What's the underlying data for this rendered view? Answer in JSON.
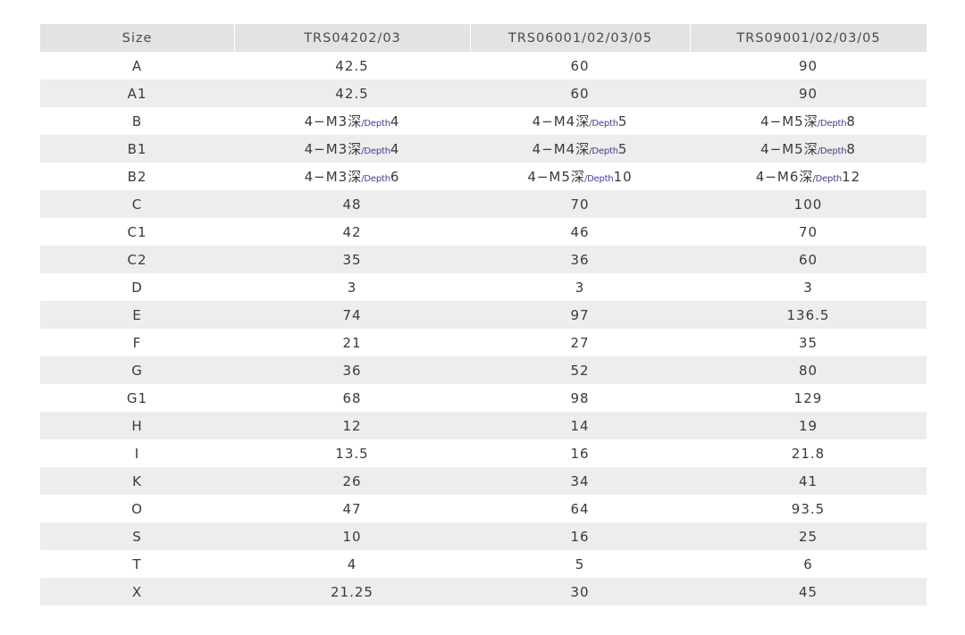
{
  "table": {
    "headers": [
      "Size",
      "TRS04202/03",
      "TRS06001/02/03/05",
      "TRS09001/02/03/05"
    ],
    "rows": [
      {
        "size": "A",
        "v": [
          "42.5",
          "60",
          "90"
        ]
      },
      {
        "size": "A1",
        "v": [
          "42.5",
          "60",
          "90"
        ]
      },
      {
        "size": "B",
        "depth": [
          {
            "pre": "4−M3",
            "cn": "深",
            "en": "/Depth",
            "num": "4"
          },
          {
            "pre": "4−M4",
            "cn": "深",
            "en": "/Depth",
            "num": "5"
          },
          {
            "pre": "4−M5",
            "cn": "深",
            "en": "/Depth",
            "num": "8"
          }
        ]
      },
      {
        "size": "B1",
        "depth": [
          {
            "pre": "4−M3",
            "cn": "深",
            "en": "/Depth",
            "num": "4"
          },
          {
            "pre": "4−M4",
            "cn": "深",
            "en": "/Depth",
            "num": "5"
          },
          {
            "pre": "4−M5",
            "cn": "深",
            "en": "/Depth",
            "num": "8"
          }
        ]
      },
      {
        "size": "B2",
        "depth": [
          {
            "pre": "4−M3",
            "cn": "深",
            "en": "/Depth",
            "num": "6"
          },
          {
            "pre": "4−M5",
            "cn": "深",
            "en": "/Depth",
            "num": "10"
          },
          {
            "pre": "4−M6",
            "cn": "深",
            "en": "/Depth",
            "num": "12"
          }
        ]
      },
      {
        "size": "C",
        "v": [
          "48",
          "70",
          "100"
        ]
      },
      {
        "size": "C1",
        "v": [
          "42",
          "46",
          "70"
        ]
      },
      {
        "size": "C2",
        "v": [
          "35",
          "36",
          "60"
        ]
      },
      {
        "size": "D",
        "v": [
          "3",
          "3",
          "3"
        ]
      },
      {
        "size": "E",
        "v": [
          "74",
          "97",
          "136.5"
        ]
      },
      {
        "size": "F",
        "v": [
          "21",
          "27",
          "35"
        ]
      },
      {
        "size": "G",
        "v": [
          "36",
          "52",
          "80"
        ]
      },
      {
        "size": "G1",
        "v": [
          "68",
          "98",
          "129"
        ]
      },
      {
        "size": "H",
        "v": [
          "12",
          "14",
          "19"
        ]
      },
      {
        "size": "I",
        "v": [
          "13.5",
          "16",
          "21.8"
        ]
      },
      {
        "size": "K",
        "v": [
          "26",
          "34",
          "41"
        ]
      },
      {
        "size": "O",
        "v": [
          "47",
          "64",
          "93.5"
        ]
      },
      {
        "size": "S",
        "v": [
          "10",
          "16",
          "25"
        ]
      },
      {
        "size": "T",
        "v": [
          "4",
          "5",
          "6"
        ]
      },
      {
        "size": "X",
        "v": [
          "21.25",
          "30",
          "45"
        ]
      }
    ]
  },
  "colors": {
    "header_bg": "#e3e3e3",
    "stripe_bg": "#ededed",
    "text": "#3a3a3a",
    "depth_accent": "#3d3f8f"
  }
}
